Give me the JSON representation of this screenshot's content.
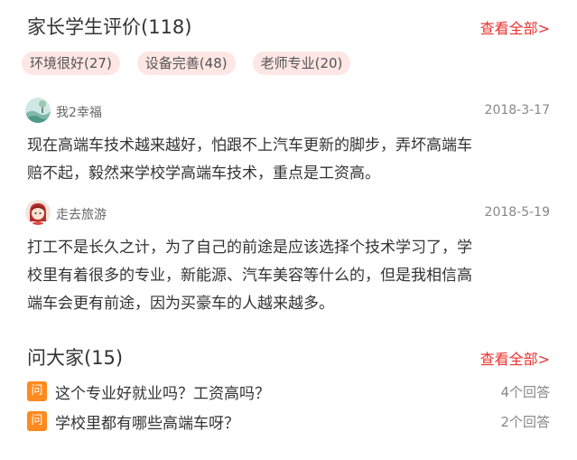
{
  "reviews_section": {
    "title": "家长学生评价(118)",
    "more_label": "查看全部>",
    "tags": [
      {
        "label": "环境很好(27)"
      },
      {
        "label": "设备完善(48)"
      },
      {
        "label": "老师专业(20)"
      }
    ],
    "reviews": [
      {
        "avatar_icon": "landscape-avatar-icon",
        "username": "我2幸福",
        "date": "2018-3-17",
        "text_lines": [
          "现在高端车技术越来越好，怕跟不上汽车更新的脚步，弄坏高端车",
          "赔不起，毅然来学校学高端车技术，重点是工资高。"
        ]
      },
      {
        "avatar_icon": "girl-avatar-icon",
        "username": "走去旅游",
        "date": "2018-5-19",
        "text_lines": [
          "打工不是长久之计，为了自己的前途是应该选择个技术学习了，学",
          "校里有着很多的专业，新能源、汽车美容等什么的，但是我相信高",
          "端车会更有前途，因为买豪车的人越来越多。"
        ]
      }
    ]
  },
  "questions_section": {
    "title": "问大家(15)",
    "more_label": "查看全部>",
    "badge_label": "问",
    "questions": [
      {
        "text": "这个专业好就业吗？工资高吗？",
        "answers": "4个回答"
      },
      {
        "text": "学校里都有哪些高端车呀？",
        "answers": "2个回答"
      }
    ]
  },
  "colors": {
    "accent_red": "#e8322f",
    "tag_bg": "#fde6e3",
    "badge_orange": "#ff8a1f"
  }
}
